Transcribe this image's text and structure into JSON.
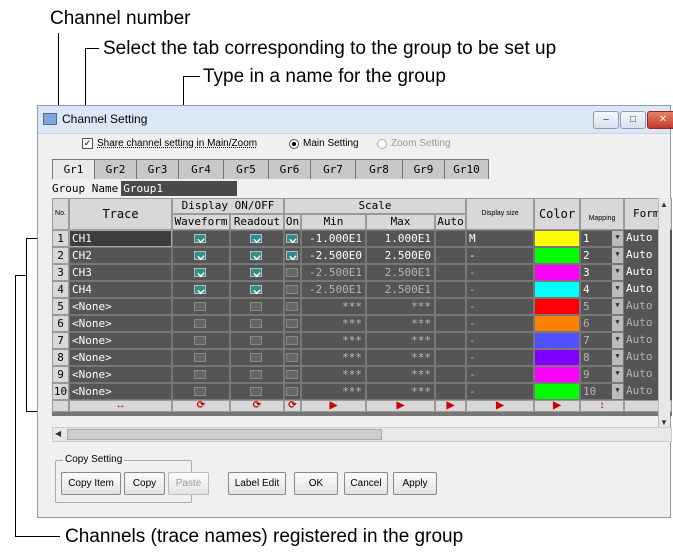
{
  "callouts": {
    "channel_number": "Channel number",
    "select_tab": "Select the tab corresponding to the group to be set up",
    "type_name": "Type in a name for the group",
    "channels": "Channels (trace names) registered in the group"
  },
  "window": {
    "title": "Channel Setting"
  },
  "options": {
    "share": "Share channel setting in Main/Zoom",
    "main": "Main Setting",
    "zoom": "Zoom Setting"
  },
  "tabs": [
    "Gr1",
    "Gr2",
    "Gr3",
    "Gr4",
    "Gr5",
    "Gr6",
    "Gr7",
    "Gr8",
    "Gr9",
    "Gr10"
  ],
  "group_name": {
    "label": "Group Name",
    "value": "Group1"
  },
  "headers": {
    "no": "No.",
    "trace": "Trace",
    "display": "Display ON/OFF",
    "waveform": "Waveform",
    "readout": "Readout",
    "scale": "Scale",
    "on": "On",
    "min": "Min",
    "max": "Max",
    "auto": "Auto",
    "display_size": "Display size",
    "color": "Color",
    "mapping": "Mapping",
    "format": "Form"
  },
  "rows": [
    {
      "no": "1",
      "trace": "CH1",
      "min": "-1.000E1",
      "max": "1.000E1",
      "size": "M",
      "map": "1",
      "fmt": "Auto",
      "color": "#ffff00"
    },
    {
      "no": "2",
      "trace": "CH2",
      "min": "-2.500E0",
      "max": "2.500E0",
      "size": "-",
      "map": "2",
      "fmt": "Auto",
      "color": "#00ff00"
    },
    {
      "no": "3",
      "trace": "CH3",
      "min": "-2.500E1",
      "max": "2.500E1",
      "size": "-",
      "map": "3",
      "fmt": "Auto",
      "color": "#ff00ff"
    },
    {
      "no": "4",
      "trace": "CH4",
      "min": "-2.500E1",
      "max": "2.500E1",
      "size": "-",
      "map": "4",
      "fmt": "Auto",
      "color": "#00ffff"
    },
    {
      "no": "5",
      "trace": "<None>",
      "min": "***",
      "max": "***",
      "size": "-",
      "map": "5",
      "fmt": "Auto",
      "color": "#ff0000"
    },
    {
      "no": "6",
      "trace": "<None>",
      "min": "***",
      "max": "***",
      "size": "-",
      "map": "6",
      "fmt": "Auto",
      "color": "#ff8000"
    },
    {
      "no": "7",
      "trace": "<None>",
      "min": "***",
      "max": "***",
      "size": "-",
      "map": "7",
      "fmt": "Auto",
      "color": "#5050ff"
    },
    {
      "no": "8",
      "trace": "<None>",
      "min": "***",
      "max": "***",
      "size": "-",
      "map": "8",
      "fmt": "Auto",
      "color": "#8000ff"
    },
    {
      "no": "9",
      "trace": "<None>",
      "min": "***",
      "max": "***",
      "size": "-",
      "map": "9",
      "fmt": "Auto",
      "color": "#ff00ff"
    },
    {
      "no": "10",
      "trace": "<None>",
      "min": "***",
      "max": "***",
      "size": "-",
      "map": "10",
      "fmt": "Auto",
      "color": "#00ff00"
    }
  ],
  "copy": {
    "label": "Copy Setting",
    "copy_item": "Copy Item",
    "copy": "Copy",
    "paste": "Paste"
  },
  "buttons": {
    "label_edit": "Label Edit",
    "ok": "OK",
    "cancel": "Cancel",
    "apply": "Apply"
  }
}
